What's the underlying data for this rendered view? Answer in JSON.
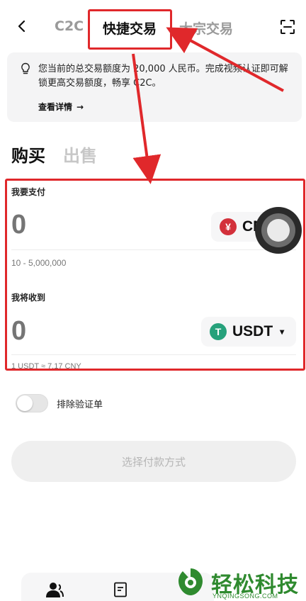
{
  "header": {
    "tabs": [
      "C2C",
      "快捷交易",
      "大宗交易"
    ]
  },
  "info": {
    "text": "您当前的总交易额度为 20,000 人民币。完成视频认证即可解锁更高交易额度，畅享 C2C。",
    "link": "查看详情",
    "link_arrow": "→"
  },
  "trade_tabs": {
    "buy": "购买",
    "sell": "出售"
  },
  "pay": {
    "label": "我要支付",
    "amount": "0",
    "currency": "CN",
    "currency_icon": "¥",
    "range": "10 - 5,000,000"
  },
  "receive": {
    "label": "我将收到",
    "amount": "0",
    "currency": "USDT",
    "currency_icon": "T",
    "dropdown": "▾",
    "rate": "1 USDT ≈ 7.17 CNY"
  },
  "toggle": {
    "label": "排除验证单",
    "on": false
  },
  "cta": {
    "label": "选择付款方式"
  },
  "watermark": {
    "brand": "轻松科技",
    "sub": "YNQINGSONG.COM"
  },
  "colors": {
    "annotation_red": "#e0282b",
    "cny_red": "#d3313b",
    "usdt_green": "#26a17b",
    "watermark_green": "#2f8a2f"
  }
}
